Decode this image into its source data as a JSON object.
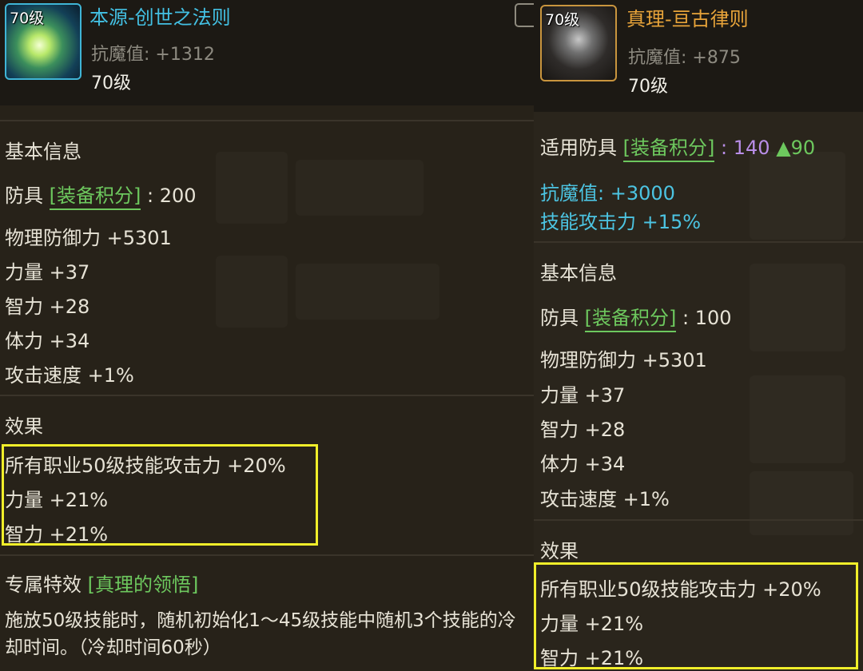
{
  "left": {
    "icon_level": "70级",
    "title": "本源-创世之法则",
    "magic_resist": "抗魔值: +1312",
    "level": "70级",
    "basic_header": "基本信息",
    "armor_label": "防具",
    "score_tag": "[装备积分]",
    "score_value": ": 200",
    "stats": [
      "物理防御力 +5301",
      "力量 +37",
      "智力 +28",
      "体力 +34",
      "攻击速度 +1%"
    ],
    "effect_header": "效果",
    "effects": [
      "所有职业50级技能攻击力 +20%",
      "力量 +21%",
      "智力 +21%"
    ],
    "exclusive_label": "专属特效",
    "exclusive_name": "[真理的领悟]",
    "exclusive_desc": "施放50级技能时，随机初始化1～45级技能中随机3个技能的冷却时间。（冷却时间60秒）"
  },
  "right": {
    "icon_level": "70级",
    "title": "真理-亘古律则",
    "magic_resist": "抗魔值: +875",
    "level": "70级",
    "applicable_label": "适用防具",
    "score_tag": "[装备积分]",
    "applicable_colon": ":",
    "applicable_value": "140",
    "applicable_up": "▲90",
    "bonus_lines": [
      "抗魔值: +3000",
      "技能攻击力 +15%"
    ],
    "basic_header": "基本信息",
    "armor_label": "防具",
    "score_value": ": 100",
    "stats": [
      "物理防御力 +5301",
      "力量 +37",
      "智力 +28",
      "体力 +34",
      "攻击速度 +1%"
    ],
    "effect_header": "效果",
    "effects": [
      "所有职业50级技能攻击力 +20%",
      "力量 +21%",
      "智力 +21%"
    ]
  },
  "colors": {
    "title_left": "#43c0e3",
    "title_right": "#e8a43a",
    "score_green": "#6dc85e",
    "score_purple": "#b98ee8",
    "highlight": "#f0ee2a"
  }
}
